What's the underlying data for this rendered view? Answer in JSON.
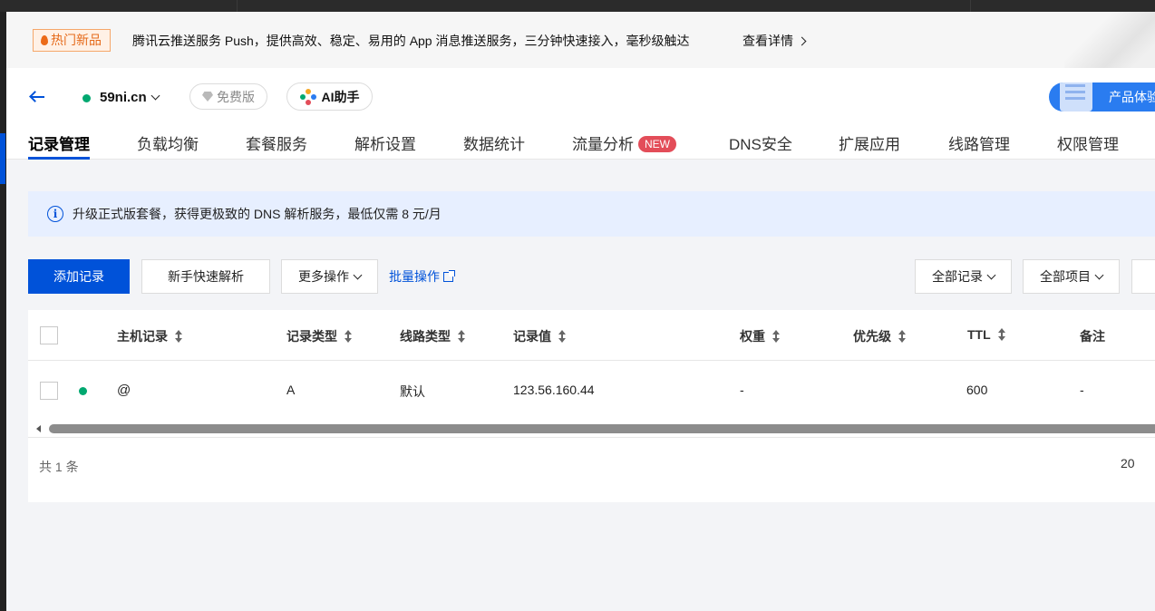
{
  "banner": {
    "tag": "热门新品",
    "text": "腾讯云推送服务 Push，提供高效、稳定、易用的 App 消息推送服务，三分钟快速接入，毫秒级触达",
    "link": "查看详情"
  },
  "header": {
    "domain": "59ni.cn",
    "plan": "免费版",
    "ai_assistant": "AI助手",
    "product_button": "产品体验"
  },
  "tabs": [
    {
      "label": "记录管理",
      "active": true
    },
    {
      "label": "负载均衡"
    },
    {
      "label": "套餐服务"
    },
    {
      "label": "解析设置"
    },
    {
      "label": "数据统计"
    },
    {
      "label": "流量分析",
      "badge": "NEW"
    },
    {
      "label": "DNS安全"
    },
    {
      "label": "扩展应用"
    },
    {
      "label": "线路管理"
    },
    {
      "label": "权限管理"
    }
  ],
  "notice": {
    "text": "升级正式版套餐，获得更极致的 DNS 解析服务，最低仅需 8 元/月"
  },
  "toolbar": {
    "add_record": "添加记录",
    "quick_resolve": "新手快速解析",
    "more_actions": "更多操作",
    "batch_actions": "批量操作",
    "all_records": "全部记录",
    "all_projects": "全部项目"
  },
  "table": {
    "columns": [
      "主机记录",
      "记录类型",
      "线路类型",
      "记录值",
      "权重",
      "优先级",
      "TTL",
      "备注"
    ],
    "rows": [
      {
        "status_color": "#00a870",
        "host": "@",
        "type": "A",
        "line": "默认",
        "value": "123.56.160.44",
        "weight": "-",
        "priority": "",
        "ttl": "600",
        "remark": "-"
      }
    ],
    "total": "共 1 条",
    "page_size": "20"
  }
}
